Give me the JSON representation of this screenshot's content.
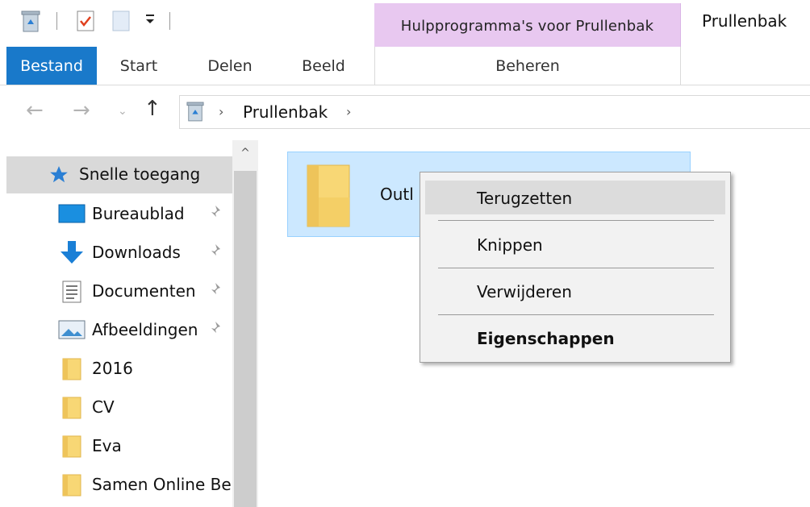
{
  "titlebar": {
    "contextual_tab_group": "Hulpprogramma's voor Prullenbak",
    "window_title": "Prullenbak",
    "quick_access_icons": [
      "recycle-bin-icon",
      "properties-icon",
      "new-folder-icon",
      "customize-dropdown-icon"
    ]
  },
  "ribbon": {
    "tabs": [
      {
        "label": "Bestand",
        "active": true
      },
      {
        "label": "Start"
      },
      {
        "label": "Delen"
      },
      {
        "label": "Beeld"
      },
      {
        "label": "Beheren"
      }
    ]
  },
  "address": {
    "back_icon": "arrow-left-icon",
    "forward_icon": "arrow-right-icon",
    "recent_icon": "chevron-down-icon",
    "up_icon": "arrow-up-icon",
    "location_icon": "recycle-bin-icon",
    "crumb": "Prullenbak"
  },
  "navigation": {
    "quick_access": "Snelle toegang",
    "items": [
      {
        "label": "Bureaublad",
        "icon": "desktop-icon",
        "pinned": true
      },
      {
        "label": "Downloads",
        "icon": "download-icon",
        "pinned": true
      },
      {
        "label": "Documenten",
        "icon": "documents-icon",
        "pinned": true
      },
      {
        "label": "Afbeeldingen",
        "icon": "pictures-icon",
        "pinned": true
      },
      {
        "label": "2016",
        "icon": "folder-icon"
      },
      {
        "label": "CV",
        "icon": "folder-icon"
      },
      {
        "label": "Eva",
        "icon": "folder-icon"
      },
      {
        "label": "Samen Online Be",
        "icon": "folder-icon"
      }
    ]
  },
  "content": {
    "items": [
      {
        "label": "Outl",
        "icon": "folder-icon",
        "selected": true
      }
    ]
  },
  "context_menu": {
    "items": [
      {
        "label": "Terugzetten",
        "highlighted": true
      },
      {
        "label": "Knippen"
      },
      {
        "label": "Verwijderen"
      },
      {
        "label": "Eigenschappen",
        "bold": true
      }
    ]
  },
  "colors": {
    "accent": "#1979ca",
    "contextual_tab": "#e8c8f0",
    "selection": "#cce8ff",
    "folder": "#f8d775"
  }
}
